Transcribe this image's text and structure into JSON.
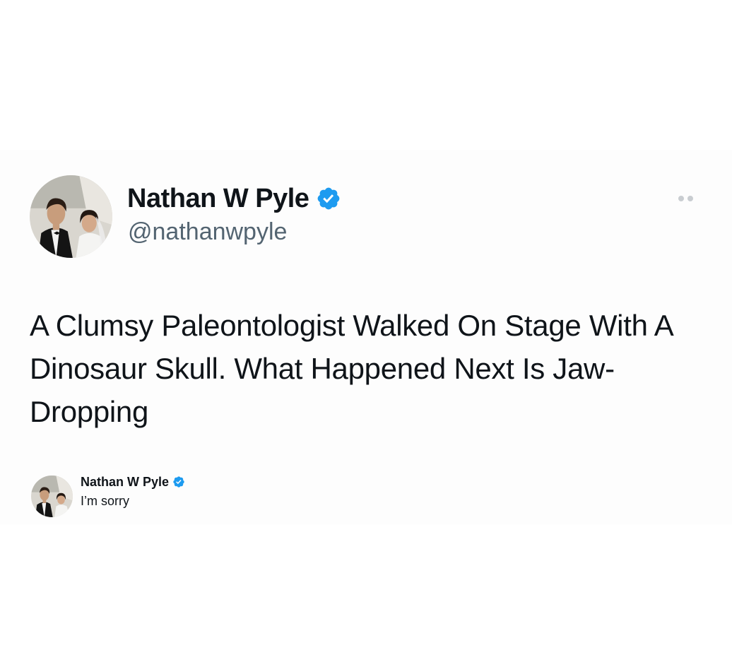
{
  "tweet": {
    "author": {
      "display_name": "Nathan W Pyle",
      "handle": "@nathanwpyle",
      "verified": true,
      "avatar": "wedding-couple-photo"
    },
    "text": "A Clumsy Paleontologist Walked On Stage With A Dinosaur Skull. What Happened Next Is Jaw-Dropping",
    "more_icon": "ellipsis-icon"
  },
  "reply": {
    "author": {
      "display_name": "Nathan W Pyle",
      "verified": true,
      "avatar": "wedding-couple-photo"
    },
    "text": "I’m sorry"
  },
  "colors": {
    "verified_blue": "#1d9bf0",
    "text_primary": "#0f1419",
    "text_secondary": "#536471",
    "menu_dots": "#c9cdd1"
  }
}
